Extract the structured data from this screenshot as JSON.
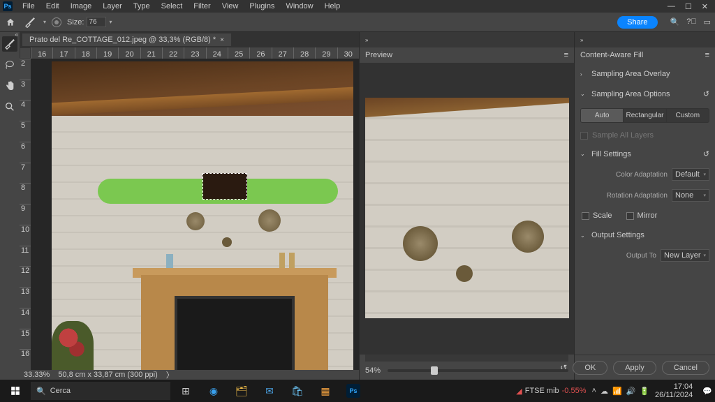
{
  "app": {
    "logo": "Ps"
  },
  "menu": [
    "File",
    "Edit",
    "Image",
    "Layer",
    "Type",
    "Select",
    "Filter",
    "View",
    "Plugins",
    "Window",
    "Help"
  ],
  "window_controls": {
    "min": "—",
    "max": "☐",
    "close": "✕"
  },
  "options": {
    "size_label": "Size:",
    "size_value": "76",
    "share": "Share"
  },
  "document": {
    "tab_title": "Prato del Re_COTTAGE_012.jpeg @ 33,3% (RGB/8) *",
    "zoom": "33.33%",
    "dims": "50,8 cm x 33,87 cm (300 ppi)"
  },
  "ruler_h": [
    "16",
    "17",
    "18",
    "19",
    "20",
    "21",
    "22",
    "23",
    "24",
    "25",
    "26",
    "27",
    "28",
    "29",
    "30"
  ],
  "ruler_v": [
    "2",
    "3",
    "4",
    "5",
    "6",
    "7",
    "8",
    "9",
    "10",
    "11",
    "12",
    "13",
    "14",
    "15",
    "16"
  ],
  "preview": {
    "title": "Preview",
    "zoom": "54%"
  },
  "caf": {
    "title": "Content-Aware Fill",
    "s_overlay": "Sampling Area Overlay",
    "s_options": "Sampling Area Options",
    "seg_auto": "Auto",
    "seg_rect": "Rectangular",
    "seg_custom": "Custom",
    "sample_all": "Sample All Layers",
    "fill": "Fill Settings",
    "color_adapt": "Color Adaptation",
    "color_adapt_v": "Default",
    "rot_adapt": "Rotation Adaptation",
    "rot_adapt_v": "None",
    "scale": "Scale",
    "mirror": "Mirror",
    "output": "Output Settings",
    "output_to": "Output To",
    "output_to_v": "New Layer",
    "ok": "OK",
    "apply": "Apply",
    "cancel": "Cancel"
  },
  "taskbar": {
    "search_placeholder": "Cerca",
    "stock_name": "FTSE mib",
    "stock_pct": "-0.55%",
    "time": "17:04",
    "date": "26/11/2024"
  }
}
